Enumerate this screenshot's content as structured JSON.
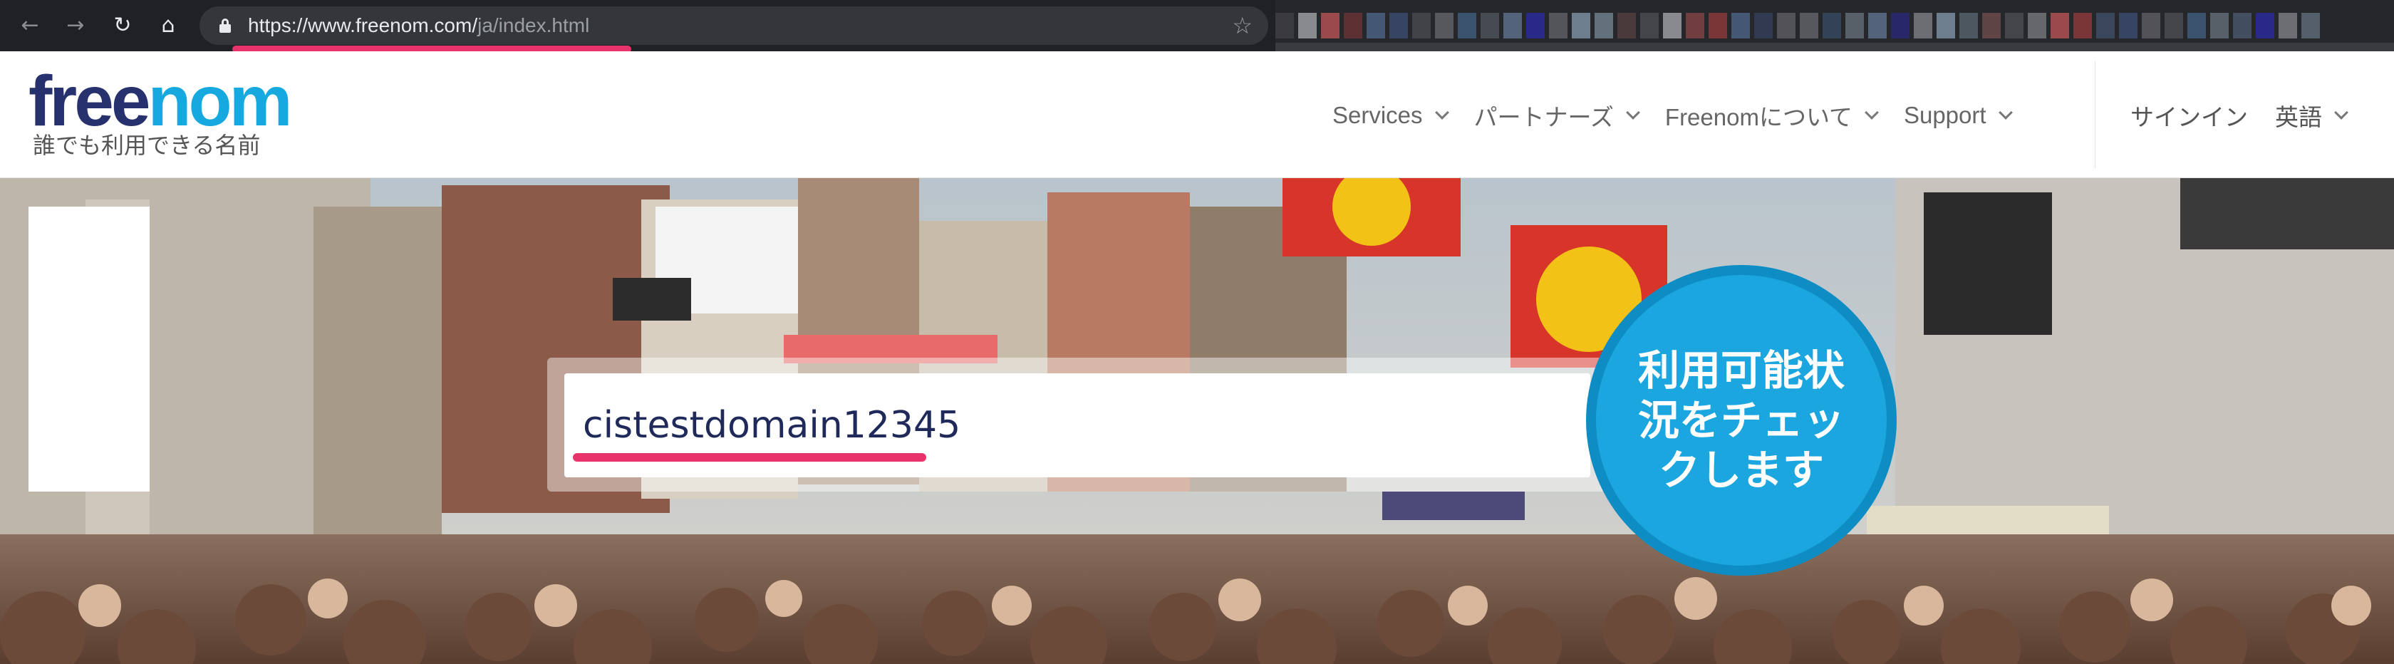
{
  "browser": {
    "url_main": "https://www.freenom.com/",
    "url_path": "ja/index.html",
    "back_icon": "back-arrow-icon",
    "forward_icon": "forward-arrow-icon",
    "reload_icon": "reload-icon",
    "home_icon": "home-icon",
    "star_icon": "bookmark-star-icon",
    "lock_icon": "lock-icon"
  },
  "header": {
    "logo_free": "free",
    "logo_nom": "nom",
    "tagline": "誰でも利用できる名前",
    "nav": [
      {
        "label": "Services"
      },
      {
        "label": "パートナーズ"
      },
      {
        "label": "Freenomについて"
      },
      {
        "label": "Support"
      }
    ],
    "signin_label": "サインイン",
    "language_label": "英語"
  },
  "hero": {
    "search_value": "cistestdomain12345",
    "check_button_label": "利用可能状況をチェックします"
  },
  "colors": {
    "brand_dark": "#26316e",
    "brand_light": "#15a9e0",
    "button": "#1ba6df",
    "annotation": "#e8336d"
  }
}
